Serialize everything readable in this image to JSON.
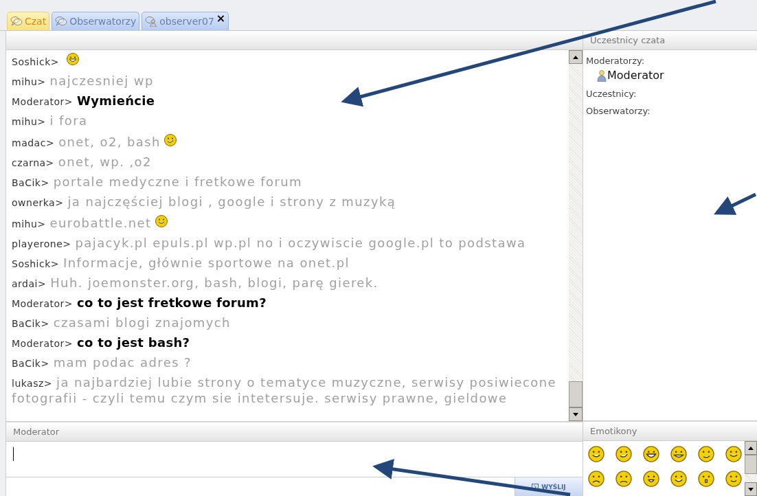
{
  "tabs": [
    {
      "label": "Czat",
      "selected": true
    },
    {
      "label": "Obserwatorzy",
      "selected": false
    },
    {
      "label": "observer07",
      "selected": false,
      "close": "×"
    }
  ],
  "chat": {
    "messages": [
      {
        "user": "Soshick>",
        "kind": "normal",
        "emoticon": {
          "kind": "laugh"
        }
      },
      {
        "user": "mihu>",
        "text": "najczesniej wp",
        "kind": "normal"
      },
      {
        "user": "Moderator>",
        "text": "Wymieńcie",
        "kind": "moderator"
      },
      {
        "user": "mihu>",
        "text": "i fora",
        "kind": "normal"
      },
      {
        "user": "madac>",
        "text": "onet, o2, bash",
        "kind": "normal",
        "emoticon": {
          "kind": "wink"
        }
      },
      {
        "user": "czarna>",
        "text": "onet, wp. ,o2",
        "kind": "normal"
      },
      {
        "user": "BaCik>",
        "text": "portale medyczne i fretkowe forum",
        "kind": "normal"
      },
      {
        "user": "ownerka>",
        "text": "ja najczęściej blogi , google i strony z muzyką",
        "kind": "normal"
      },
      {
        "user": "mihu>",
        "text": "eurobattle.net",
        "kind": "normal",
        "emoticon": {
          "kind": "smile"
        }
      },
      {
        "user": "playerone>",
        "text": "pajacyk.pl epuls.pl wp.pl no i oczywiscie google.pl to podstawa",
        "kind": "normal"
      },
      {
        "user": "Soshick>",
        "text": "Informacje, głównie sportowe na onet.pl",
        "kind": "normal"
      },
      {
        "user": "ardai>",
        "text": "Huh. joemonster.org, bash, blogi, parę gierek.",
        "kind": "normal"
      },
      {
        "user": "Moderator>",
        "text": "co to jest fretkowe forum?",
        "kind": "moderator"
      },
      {
        "user": "BaCik>",
        "text": "czasami blogi znajomych",
        "kind": "normal"
      },
      {
        "user": "Moderator>",
        "text": "co to jest bash?",
        "kind": "moderator"
      },
      {
        "user": "BaCik>",
        "text": "mam podac adres ?",
        "kind": "normal"
      },
      {
        "user": "lukasz>",
        "text": "ja najbardziej lubie strony o tematyce muzyczne, serwisy posiwiecone fotografii - czyli temu czym sie intetersuje. serwisy prawne, gieldowe",
        "kind": "normal"
      }
    ]
  },
  "participants": {
    "title": "Uczestnicy czata",
    "groups": [
      {
        "label": "Moderatorzy:",
        "members": [
          "Moderator"
        ]
      },
      {
        "label": "Uczestnicy:"
      },
      {
        "label": "Obserwatorzy:"
      }
    ]
  },
  "input": {
    "title": "Moderator",
    "send_button": "WYŚLIJ"
  },
  "emoticons": {
    "title": "Emotikony"
  }
}
